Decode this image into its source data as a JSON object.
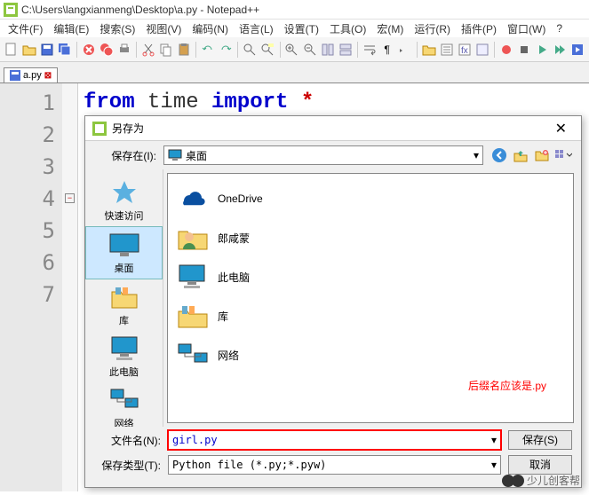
{
  "window": {
    "title": "C:\\Users\\langxianmeng\\Desktop\\a.py - Notepad++"
  },
  "menus": [
    "文件(F)",
    "编辑(E)",
    "搜索(S)",
    "视图(V)",
    "编码(N)",
    "语言(L)",
    "设置(T)",
    "工具(O)",
    "宏(M)",
    "运行(R)",
    "插件(P)",
    "窗口(W)",
    "?"
  ],
  "tab": {
    "label": "a.py"
  },
  "gutter": [
    "1",
    "2",
    "3",
    "4",
    "5",
    "6",
    "7"
  ],
  "code": {
    "kw1": "from",
    "id1": "time",
    "kw2": "import",
    "op": "*"
  },
  "dialog": {
    "title": "另存为",
    "close": "✕",
    "loc_label": "保存在(I):",
    "loc_value": "桌面",
    "sidebar": [
      {
        "label": "快速访问",
        "icon": "star"
      },
      {
        "label": "桌面",
        "icon": "desktop",
        "selected": true
      },
      {
        "label": "库",
        "icon": "libs"
      },
      {
        "label": "此电脑",
        "icon": "pc"
      },
      {
        "label": "网络",
        "icon": "net"
      }
    ],
    "files": [
      {
        "label": "OneDrive",
        "icon": "cloud"
      },
      {
        "label": "郎咸蒙",
        "icon": "user"
      },
      {
        "label": "此电脑",
        "icon": "pc"
      },
      {
        "label": "库",
        "icon": "libs"
      },
      {
        "label": "网络",
        "icon": "net"
      }
    ],
    "annotation": "后缀名应该是.py",
    "filename_label": "文件名(N):",
    "filename_value": "girl.py",
    "filetype_label": "保存类型(T):",
    "filetype_value": "Python file (*.py;*.pyw)",
    "save_btn": "保存(S)",
    "cancel_btn": "取消"
  },
  "watermark": "少儿创客帮"
}
